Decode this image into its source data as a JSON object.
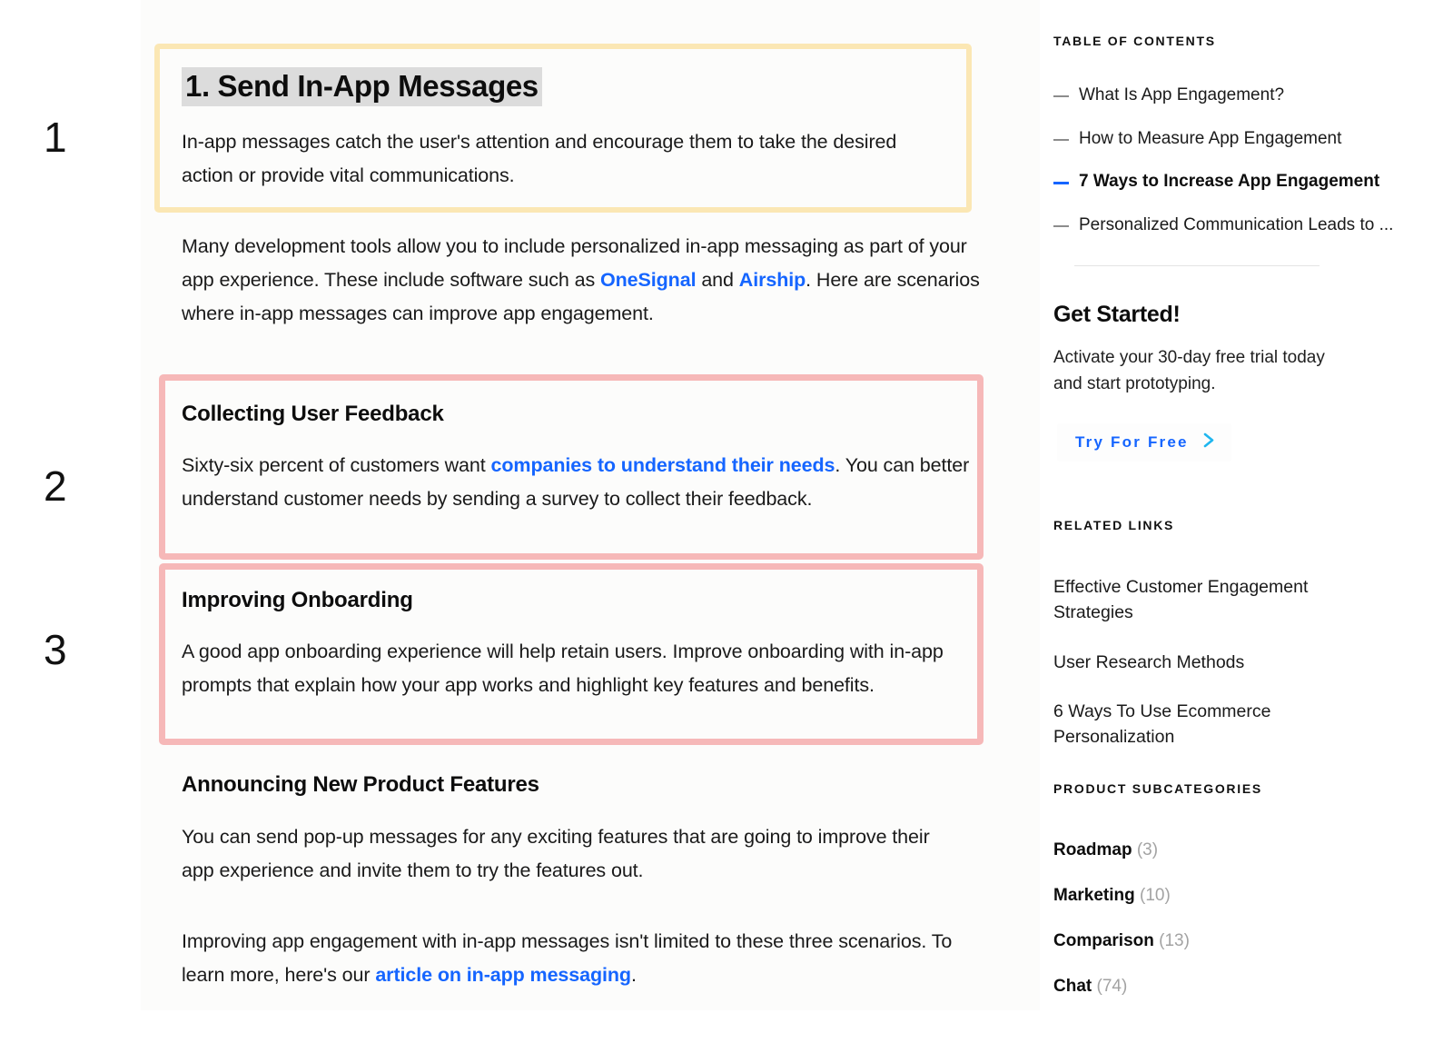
{
  "annotations": {
    "markers": [
      {
        "label": "1"
      },
      {
        "label": "2"
      },
      {
        "label": "3"
      }
    ]
  },
  "article": {
    "heading_1": "1. Send In-App Messages",
    "paragraph_1": "In-app messages catch the user's attention and encourage them to take the desired action or provide vital communications.",
    "paragraph_2": {
      "part_1": "Many development tools allow you to include personalized in-app messaging as part of your app experience. These include software such as ",
      "link_1": "OneSignal",
      "part_2": " and ",
      "link_2": "Airship",
      "part_3": ". Here are scenarios where in-app messages can improve app engagement."
    },
    "heading_2": "Collecting User Feedback",
    "paragraph_3": {
      "part_1": "Sixty-six percent of customers want ",
      "link_1": "companies to understand their needs",
      "part_2": ". You can better understand customer needs by sending a survey to collect their feedback."
    },
    "heading_3": "Improving Onboarding",
    "paragraph_4": "A good app onboarding experience will help retain users. Improve onboarding with in-app prompts that explain how your app works and highlight key features and benefits.",
    "heading_4": "Announcing New Product Features",
    "paragraph_5": "You can send pop-up messages for any exciting features that are going to improve their app experience and invite them to try the features out.",
    "paragraph_6": {
      "part_1": "Improving app engagement with in-app messages isn't limited to these three scenarios. To learn more, here's our ",
      "link_1": "article on in-app messaging",
      "part_2": "."
    }
  },
  "sidebar": {
    "toc": {
      "label": "Table of Contents",
      "items": [
        {
          "label": "What Is App Engagement?",
          "active": false
        },
        {
          "label": "How to Measure App Engagement",
          "active": false
        },
        {
          "label": "7 Ways to Increase App Engagement",
          "active": true
        },
        {
          "label": "Personalized Communication Leads to ...",
          "active": false
        }
      ]
    },
    "get_started": {
      "title": "Get Started!",
      "text": "Activate your 30-day free trial today and start prototyping.",
      "cta_label": "Try For Free",
      "cta_icon": "chevron-right-icon"
    },
    "related_links": {
      "label": "Related Links",
      "items": [
        "Effective Customer Engagement Strategies",
        "User Research Methods",
        "6 Ways To Use Ecommerce Personalization"
      ]
    },
    "product_subcategories": {
      "label": "Product Subcategories",
      "items": [
        {
          "name": "Roadmap",
          "count": "(3)"
        },
        {
          "name": "Marketing",
          "count": "(10)"
        },
        {
          "name": "Comparison",
          "count": "(13)"
        },
        {
          "name": "Chat",
          "count": "(74)"
        }
      ]
    }
  },
  "colors": {
    "link_blue": "#1565ff",
    "cta_blue": "#1565ff",
    "cta_chevron": "#1fb6ef",
    "highlight_yellow": "#fbe7b4",
    "highlight_pink": "#f6b8b8",
    "heading_selection_gray": "#dcdcdc",
    "count_gray": "#a3a3a3"
  }
}
